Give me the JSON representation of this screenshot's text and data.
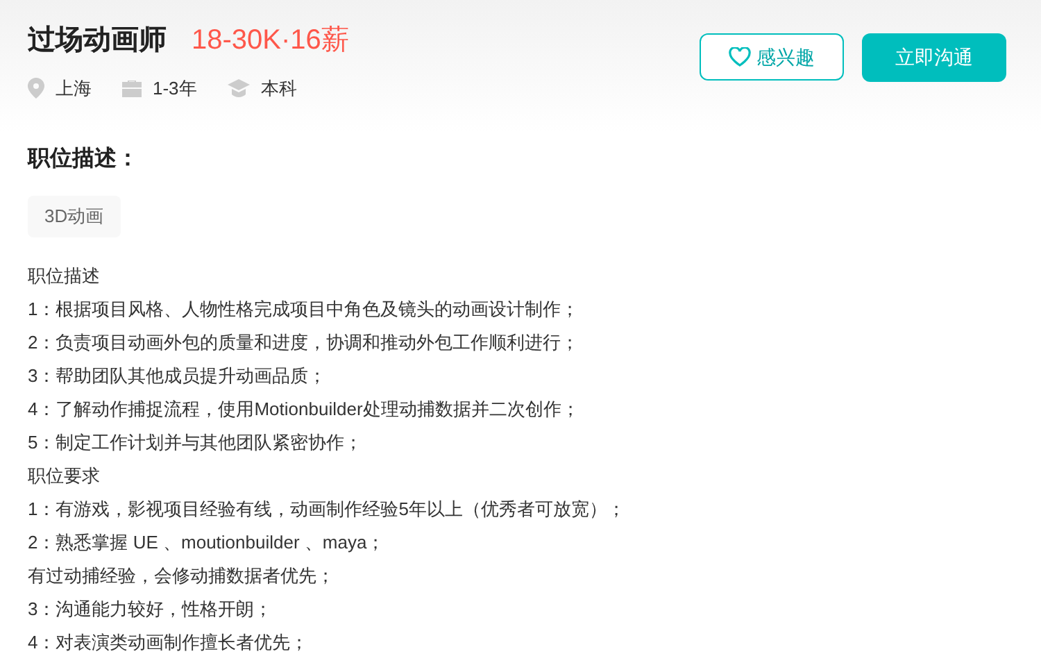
{
  "job": {
    "title": "过场动画师",
    "salary": "18-30K·16薪",
    "meta": [
      {
        "kind": "location",
        "text": "上海"
      },
      {
        "kind": "experience",
        "text": "1-3年"
      },
      {
        "kind": "education",
        "text": "本科"
      }
    ],
    "buttons": [
      {
        "kind": "outline",
        "label": "感兴趣"
      },
      {
        "kind": "primary",
        "label": "立即沟通"
      }
    ]
  },
  "description": {
    "heading": "职位描述：",
    "tags": [
      "3D动画"
    ],
    "lines": [
      "职位描述",
      "1：根据项目风格、人物性格完成项目中角色及镜头的动画设计制作；",
      "2：负责项目动画外包的质量和进度，协调和推动外包工作顺利进行；",
      "3：帮助团队其他成员提升动画品质；",
      "4：了解动作捕捉流程，使用Motionbuilder处理动捕数据并二次创作；",
      "5：制定工作计划并与其他团队紧密协作；",
      "职位要求",
      "1：有游戏，影视项目经验有线，动画制作经验5年以上（优秀者可放宽）；",
      "2：熟悉掌握 UE 、moutionbuilder 、maya；",
      "有过动捕经验，会修动捕数据者优先；",
      "3：沟通能力较好，性格开朗；",
      "4：对表演类动画制作擅长者优先；"
    ]
  }
}
